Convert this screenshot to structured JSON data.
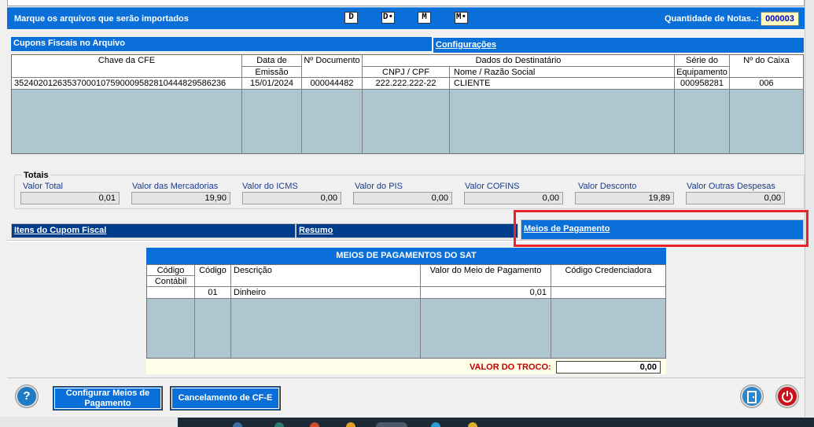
{
  "header": {
    "title": "Marque os arquivos que serão importados",
    "buttons": [
      "D",
      "D•",
      "M",
      "M•"
    ],
    "qty_label": "Quantidade de Notas..:",
    "qty_value": "000003"
  },
  "tabs_top": {
    "cupons": "Cupons Fiscais no Arquivo",
    "config": "Configurações"
  },
  "cfe_table": {
    "headers": {
      "chave": "Chave da CFE",
      "data1": "Data de",
      "data2": "Emissão",
      "doc": "Nº Documento",
      "dest": "Dados do Destinatário",
      "cnpj": "CNPJ / CPF",
      "nome": "Nome / Razão Social",
      "serie1": "Série do",
      "serie2": "Equipamento",
      "caixa": "Nº do Caixa"
    },
    "rows": [
      {
        "chave": "35240201263537000107590009582810444829586236",
        "data": "15/01/2024",
        "doc": "000044482",
        "cnpj": "222.222.222-22",
        "nome": "CLIENTE",
        "serie": "000958281",
        "caixa": "006"
      }
    ]
  },
  "totais": {
    "title": "Totais",
    "items": [
      {
        "label": "Valor Total",
        "value": "0,01"
      },
      {
        "label": "Valor das Mercadorias",
        "value": "19,90"
      },
      {
        "label": "Valor do ICMS",
        "value": "0,00"
      },
      {
        "label": "Valor do PIS",
        "value": "0,00"
      },
      {
        "label": "Valor COFINS",
        "value": "0,00"
      },
      {
        "label": "Valor Desconto",
        "value": "19,89"
      },
      {
        "label": "Valor Outras Despesas",
        "value": "0,00"
      }
    ]
  },
  "tabs_mid": {
    "itens": "Itens do Cupom Fiscal",
    "resumo": "Resumo",
    "meios": "Meios de Pagamento"
  },
  "sat": {
    "title": "MEIOS DE PAGAMENTOS DO SAT",
    "headers": {
      "cod_contabil1": "Código",
      "cod_contabil2": "Contábil",
      "codigo": "Código",
      "descricao": "Descrição",
      "valor": "Valor do Meio de Pagamento",
      "credenciadora": "Código Credenciadora"
    },
    "rows": [
      {
        "cod_contabil": "",
        "codigo": "01",
        "descricao": "Dinheiro",
        "valor": "0,01",
        "credenciadora": ""
      }
    ],
    "troco_label": "VALOR DO TROCO:",
    "troco_value": "0,00"
  },
  "footer": {
    "help": "?",
    "config_btn": "Configurar Meios de Pagamento",
    "cancel_btn": "Cancelamento de CF-E"
  },
  "colors": {
    "accent": "#0a6fd8",
    "dark_tab": "#003c8c",
    "grid_bg": "#aec6d0",
    "highlight": "#e8232a",
    "troco_red": "#c00000"
  }
}
